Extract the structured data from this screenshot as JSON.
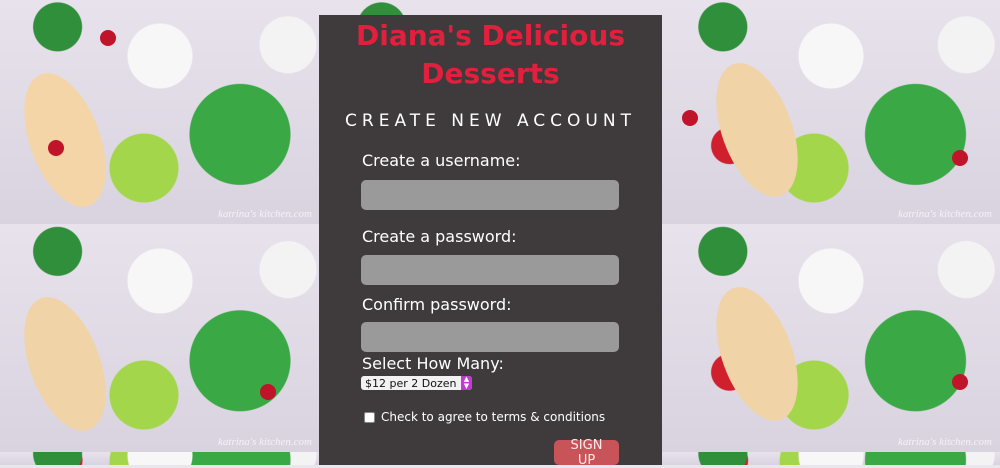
{
  "brand": {
    "title": "Diana's Delicious Desserts",
    "color": "#e0203c"
  },
  "form": {
    "heading": "CREATE NEW ACCOUNT",
    "username_label": "Create a username:",
    "username_value": "",
    "password_label": "Create a password:",
    "password_value": "",
    "confirm_label": "Confirm password:",
    "confirm_value": "",
    "select_label": "Select How Many:",
    "select_value": "$12 per 2 Dozen",
    "terms_label": "Check to agree to terms & conditions",
    "terms_checked": false,
    "signup_label": "SIGN UP"
  },
  "background": {
    "watermark": "katrina's kitchen.com",
    "colors": {
      "panel": "#3f3b3c",
      "field": "#9a9a9a",
      "button": "#c8545a"
    }
  }
}
